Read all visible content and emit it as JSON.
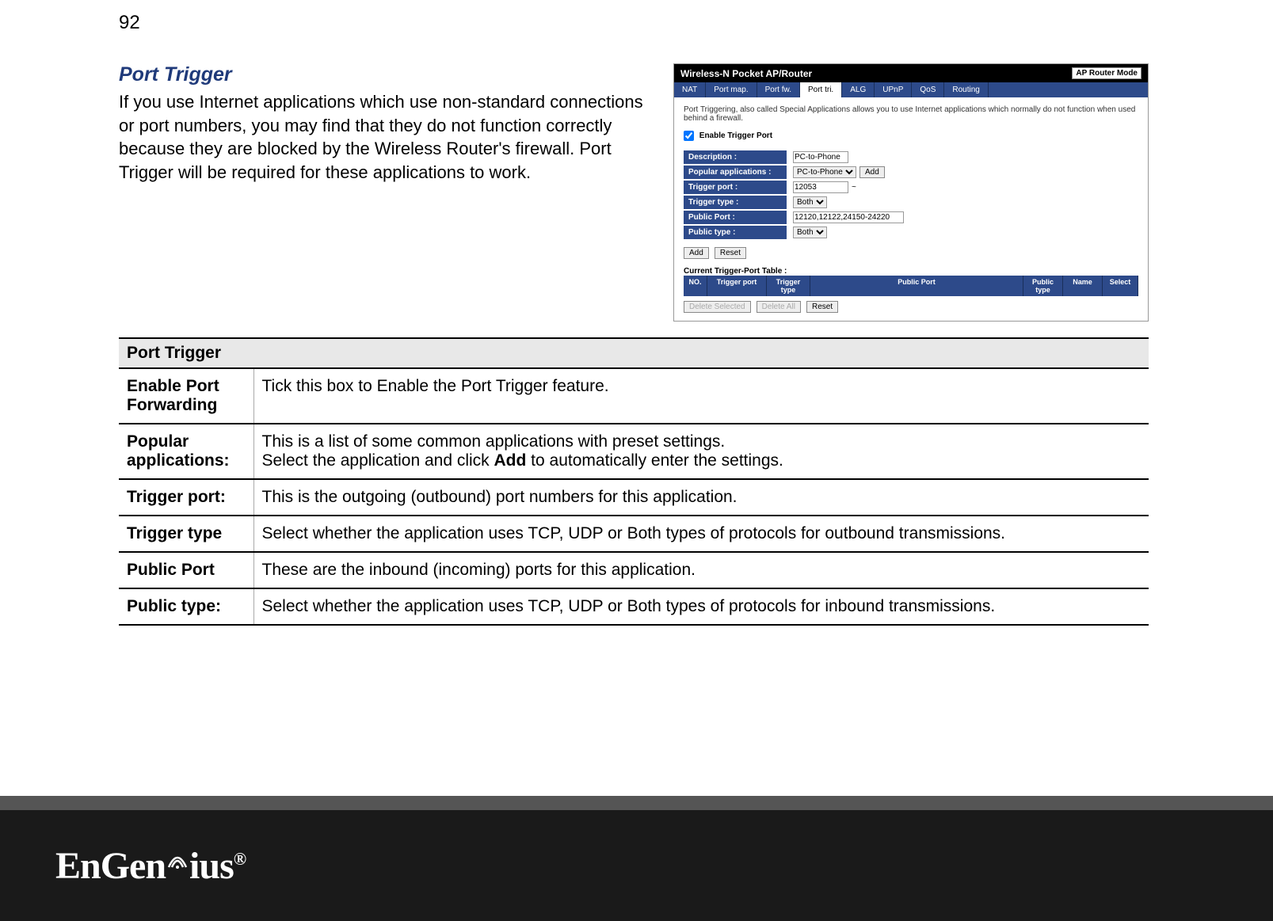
{
  "page_number": "92",
  "section": {
    "title": "Port Trigger",
    "body": "If you use Internet applications which use non-standard connections or port numbers, you may find that they do not function correctly because they are blocked by the Wireless Router's firewall. Port Trigger will be required for these applications to work."
  },
  "router": {
    "header_title": "Wireless-N Pocket AP/Router",
    "mode": "AP Router Mode",
    "tabs": [
      "NAT",
      "Port map.",
      "Port fw.",
      "Port tri.",
      "ALG",
      "UPnP",
      "QoS",
      "Routing"
    ],
    "active_tab": "Port tri.",
    "intro": "Port Triggering, also called Special Applications allows you to use Internet applications which normally do not function when used behind a firewall.",
    "enable_label": "Enable Trigger Port",
    "enable_checked": true,
    "fields": {
      "description_label": "Description :",
      "description_value": "PC-to-Phone",
      "popular_label": "Popular applications :",
      "popular_value": "PC-to-Phone",
      "trigger_port_label": "Trigger port :",
      "trigger_port_value": "12053",
      "trigger_type_label": "Trigger type :",
      "trigger_type_value": "Both",
      "public_port_label": "Public Port :",
      "public_port_value": "12120,12122,24150-24220",
      "public_type_label": "Public type :",
      "public_type_value": "Both"
    },
    "buttons": {
      "add": "Add",
      "reset": "Reset",
      "add_popular": "Add"
    },
    "table_title": "Current Trigger-Port Table :",
    "table_headers": [
      "NO.",
      "Trigger port",
      "Trigger type",
      "Public Port",
      "Public type",
      "Name",
      "Select"
    ],
    "bottom_buttons": {
      "delete_selected": "Delete Selected",
      "delete_all": "Delete All",
      "reset": "Reset"
    }
  },
  "desc_table": {
    "header": "Port Trigger",
    "rows": [
      {
        "key": "Enable Port Forwarding",
        "val": "Tick this box to Enable the Port Trigger feature."
      },
      {
        "key": "Popular applications:",
        "val_line1": "This is a list of some common applications with preset settings.",
        "val_line2a": "Select the application and click ",
        "val_line2b": "Add",
        "val_line2c": " to automatically enter the settings."
      },
      {
        "key": "Trigger port:",
        "val": "This is the outgoing (outbound) port numbers for this application."
      },
      {
        "key": "Trigger type",
        "val": "Select whether the application uses TCP, UDP or Both types of protocols for outbound transmissions."
      },
      {
        "key": "Public Port",
        "val": "These are the inbound (incoming) ports for this application."
      },
      {
        "key": "Public type:",
        "val": "Select whether the application uses TCP, UDP or Both types of protocols for inbound transmissions."
      }
    ]
  },
  "footer": {
    "brand": "EnGenius",
    "reg": "®"
  }
}
